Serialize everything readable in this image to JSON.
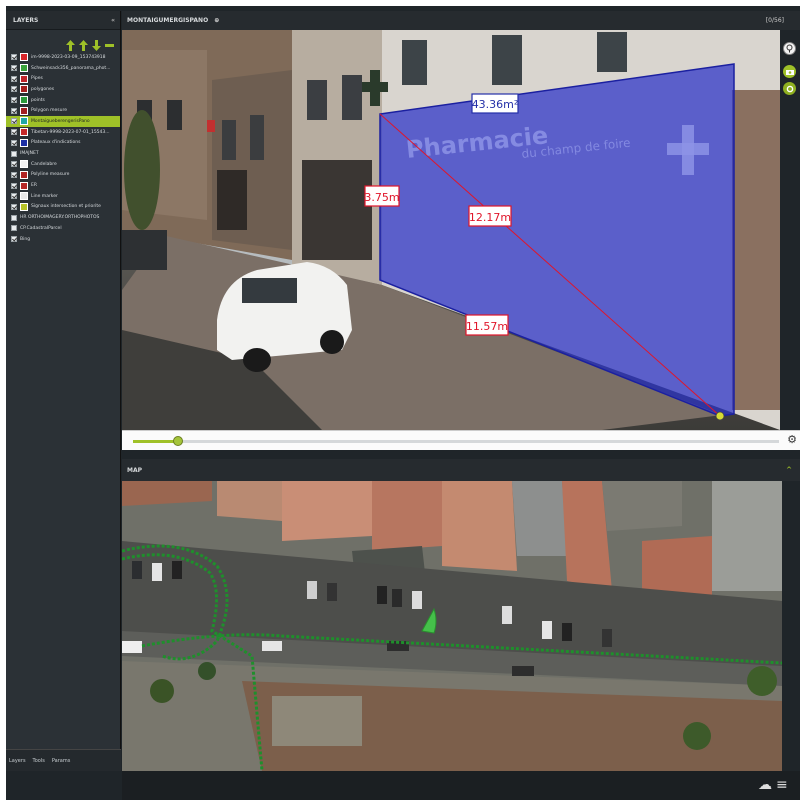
{
  "layers_panel": {
    "title": "LAYERS",
    "collapse_glyph": "«",
    "toolbar": [
      "move-up-icon",
      "move-down-icon",
      "collapse-all-icon"
    ],
    "items": [
      {
        "label": "im-9998-2023-03-09_153743918",
        "checked": true,
        "color": "#d8262a"
      },
      {
        "label": "Schweinsack356_panorama_phot...",
        "checked": true,
        "color": "#3aa33a"
      },
      {
        "label": "Pipes",
        "checked": true,
        "color": "#c0262b"
      },
      {
        "label": "polygones",
        "checked": true,
        "color": "#a6201f"
      },
      {
        "label": "points",
        "checked": true,
        "color": "#2c9b3c"
      },
      {
        "label": "Polygon mesure",
        "checked": true,
        "color": "#a22020"
      },
      {
        "label": "MontaigueberengerisPano",
        "checked": true,
        "color": "#20a7a5",
        "active": true
      },
      {
        "label": "Tibetan-9998-2023-07-01_15543...",
        "checked": true,
        "color": "#c62a2a"
      },
      {
        "label": "Plateaux d'indications",
        "checked": true,
        "color": "#1d2fa4"
      },
      {
        "label": "IMAJNET",
        "checked": false,
        "color": ""
      },
      {
        "label": "Candelabre",
        "checked": true,
        "color": "#f2f2f2"
      },
      {
        "label": "Polyline measure",
        "checked": true,
        "color": "#b12424"
      },
      {
        "label": "ER",
        "checked": true,
        "color": "#b52727"
      },
      {
        "label": "Line marker",
        "checked": true,
        "color": "#e8e8e8"
      },
      {
        "label": "Signaux intersection et priorite",
        "checked": true,
        "color": "#b6c227"
      },
      {
        "label": "HR ORTHOIMAGERY.ORTHOPHOTOS",
        "checked": false,
        "color": ""
      },
      {
        "label": "CP.CadastralParcel",
        "checked": false,
        "color": ""
      },
      {
        "label": "Bing",
        "checked": true,
        "color": ""
      }
    ],
    "footer_tabs": [
      "Layers",
      "Tools",
      "Params"
    ]
  },
  "pano": {
    "title": "MONTAIGUMERGISPANO",
    "title_icon": "link-icon",
    "counter": "[0/56]",
    "storefront_text": "Pharmacie",
    "storefront_subtext": "du champ de foire",
    "measurements": {
      "area": "43.36m²",
      "height": "3.75m",
      "diagonal": "12.17m",
      "width": "11.57m"
    },
    "progress": 0.07,
    "side_tools": [
      "info-icon",
      "camera-icon",
      "settings-icon"
    ]
  },
  "map": {
    "title": "MAP",
    "collapse_glyph": "^"
  },
  "colors": {
    "accent": "#9fc128",
    "measure_fill": "#2a32c8",
    "label_red": "#e0152a",
    "label_blue": "#2430a8",
    "track": "#1f8f2c"
  }
}
